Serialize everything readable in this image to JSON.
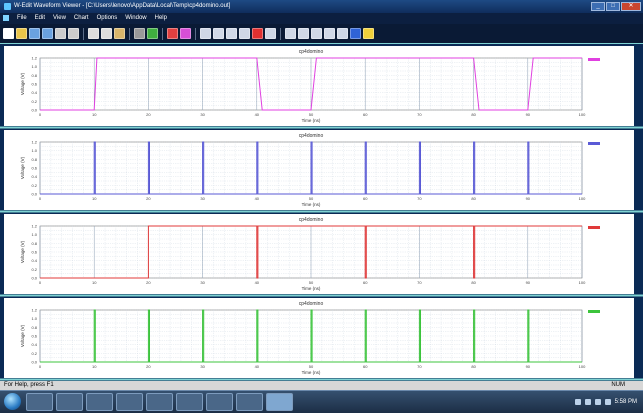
{
  "window": {
    "title": "W-Edit Waveform Viewer - [C:\\Users\\lenovo\\AppData\\Local\\Temp\\cp4domino.out]",
    "controls": [
      "_",
      "□",
      "✕"
    ]
  },
  "menu": [
    "File",
    "Edit",
    "View",
    "Chart",
    "Options",
    "Window",
    "Help"
  ],
  "toolbar_icons": [
    {
      "name": "new-icon",
      "color": "#ffffff"
    },
    {
      "name": "open-icon",
      "color": "#e8c44a"
    },
    {
      "name": "save-icon",
      "color": "#6aa2e0"
    },
    {
      "name": "save-all-icon",
      "color": "#6aa2e0"
    },
    {
      "name": "print-icon",
      "color": "#cccccc"
    },
    {
      "name": "print-preview-icon",
      "color": "#cccccc"
    },
    {
      "sep": true
    },
    {
      "name": "cut-icon",
      "color": "#dddddd"
    },
    {
      "name": "copy-icon",
      "color": "#dddddd"
    },
    {
      "name": "paste-icon",
      "color": "#d9b66b"
    },
    {
      "sep": true
    },
    {
      "name": "grid-icon",
      "color": "#9a9a9a"
    },
    {
      "name": "chart-green-icon",
      "color": "#3fae3f"
    },
    {
      "sep": true
    },
    {
      "name": "trace-red-icon",
      "color": "#e04040"
    },
    {
      "name": "trace-multi-icon",
      "color": "#d64fd6"
    },
    {
      "sep": true
    },
    {
      "name": "zoom-in-icon",
      "color": "#cfd7e6"
    },
    {
      "name": "zoom-out-icon",
      "color": "#cfd7e6"
    },
    {
      "name": "zoom-fit-icon",
      "color": "#cfd7e6"
    },
    {
      "name": "expand-icon",
      "color": "#cfd7e6"
    },
    {
      "name": "flag-red-icon",
      "color": "#e03030"
    },
    {
      "name": "cursor-icon",
      "color": "#cfd7e6"
    },
    {
      "sep": true
    },
    {
      "name": "split-icon",
      "color": "#cfd7e6"
    },
    {
      "name": "stack-icon",
      "color": "#cfd7e6"
    },
    {
      "name": "step-icon",
      "color": "#cfd7e6"
    },
    {
      "name": "pause-icon",
      "color": "#cfd7e6"
    },
    {
      "name": "play-icon",
      "color": "#cfd7e6"
    },
    {
      "name": "blue-box-icon",
      "color": "#2f63d6"
    },
    {
      "name": "bulb-icon",
      "color": "#f0d03a"
    }
  ],
  "status": {
    "left": "For Help, press F1",
    "right": "NUM"
  },
  "taskbar": {
    "time": "5:58 PM",
    "app_count": 9,
    "active_app": 8
  },
  "colors": {
    "plot_bg": "#ffffff",
    "frame_bg": "#0a2a55",
    "divider": "#7fd3d3",
    "grid": "#b9c6d6"
  },
  "chart_data": [
    {
      "type": "line",
      "title": "cp4domino",
      "xlabel": "Time (ns)",
      "ylabel": "Voltage (V)",
      "xlim": [
        0,
        100
      ],
      "ylim": [
        0,
        1.2
      ],
      "yticks": [
        "0.0",
        "0.2",
        "0.4",
        "0.6",
        "0.8",
        "1.0",
        "1.2"
      ],
      "xticks": [
        "0",
        "10",
        "20",
        "30",
        "40",
        "50",
        "60",
        "70",
        "80",
        "90",
        "100"
      ],
      "legend": "top-right",
      "series": [
        {
          "color": "#e040e0",
          "x": [
            0,
            10,
            10.5,
            40,
            41,
            50,
            51,
            80,
            81,
            90,
            91,
            100
          ],
          "y": [
            0.0,
            0.0,
            1.2,
            1.2,
            0.0,
            0.0,
            1.2,
            1.2,
            0.0,
            0.0,
            1.2,
            1.2
          ]
        }
      ]
    },
    {
      "type": "line",
      "title": "cp4domino",
      "xlabel": "Time (ns)",
      "ylabel": "Voltage (V)",
      "xlim": [
        0,
        100
      ],
      "ylim": [
        0,
        1.2
      ],
      "yticks": [
        "0.0",
        "0.2",
        "0.4",
        "0.6",
        "0.8",
        "1.0",
        "1.2"
      ],
      "xticks": [
        "0",
        "10",
        "20",
        "30",
        "40",
        "50",
        "60",
        "70",
        "80",
        "90",
        "100"
      ],
      "legend": "top-right",
      "series": [
        {
          "color": "#5a5ad6",
          "x": [
            0,
            10,
            10,
            10.2,
            10.2,
            20,
            20,
            20.2,
            20.2,
            30,
            30,
            30.2,
            30.2,
            40,
            40,
            40.2,
            40.2,
            50,
            50,
            50.2,
            50.2,
            60,
            60,
            60.2,
            60.2,
            70,
            70,
            70.2,
            70.2,
            80,
            80,
            80.2,
            80.2,
            90,
            90,
            90.2,
            90.2,
            100
          ],
          "y": [
            0,
            0,
            1.2,
            1.2,
            0,
            0,
            1.2,
            1.2,
            0,
            0,
            1.2,
            1.2,
            0,
            0,
            1.2,
            1.2,
            0,
            0,
            1.2,
            1.2,
            0,
            0,
            1.2,
            1.2,
            0,
            0,
            1.2,
            1.2,
            0,
            0,
            1.2,
            1.2,
            0,
            0,
            1.2,
            1.2,
            0,
            0
          ]
        }
      ]
    },
    {
      "type": "line",
      "title": "cp4domino",
      "xlabel": "Time (ns)",
      "ylabel": "Voltage (V)",
      "xlim": [
        0,
        100
      ],
      "ylim": [
        0,
        1.2
      ],
      "yticks": [
        "0.0",
        "0.2",
        "0.4",
        "0.6",
        "0.8",
        "1.0",
        "1.2"
      ],
      "xticks": [
        "0",
        "10",
        "20",
        "30",
        "40",
        "50",
        "60",
        "70",
        "80",
        "90",
        "100"
      ],
      "legend": "top-right",
      "series": [
        {
          "color": "#e03a3a",
          "x": [
            0,
            20,
            20,
            40,
            40,
            40.2,
            40.2,
            60,
            60,
            60.2,
            60.2,
            80,
            80,
            80.2,
            80.2,
            100
          ],
          "y": [
            0,
            0,
            1.2,
            1.2,
            0,
            0,
            1.2,
            1.2,
            0,
            0,
            1.2,
            1.2,
            0,
            0,
            1.2,
            1.2
          ]
        }
      ]
    },
    {
      "type": "line",
      "title": "cp4domino",
      "xlabel": "Time (ns)",
      "ylabel": "Voltage (V)",
      "xlim": [
        0,
        100
      ],
      "ylim": [
        0,
        1.2
      ],
      "yticks": [
        "0.0",
        "0.2",
        "0.4",
        "0.6",
        "0.8",
        "1.0",
        "1.2"
      ],
      "xticks": [
        "0",
        "10",
        "20",
        "30",
        "40",
        "50",
        "60",
        "70",
        "80",
        "90",
        "100"
      ],
      "legend": "top-right",
      "series": [
        {
          "color": "#3cc43c",
          "x": [
            0,
            10,
            10,
            10.2,
            10.2,
            20,
            20,
            20.2,
            20.2,
            30,
            30,
            30.2,
            30.2,
            40,
            40,
            40.2,
            40.2,
            50,
            50,
            50.2,
            50.2,
            60,
            60,
            60.2,
            60.2,
            70,
            70,
            70.2,
            70.2,
            80,
            80,
            80.2,
            80.2,
            90,
            90,
            90.2,
            90.2,
            100
          ],
          "y": [
            0,
            0,
            1.2,
            1.2,
            0,
            0,
            1.2,
            1.2,
            0,
            0,
            1.2,
            1.2,
            0,
            0,
            1.2,
            1.2,
            0,
            0,
            1.2,
            1.2,
            0,
            0,
            1.2,
            1.2,
            0,
            0,
            1.2,
            1.2,
            0,
            0,
            1.2,
            1.2,
            0,
            0,
            1.2,
            1.2,
            0,
            0
          ]
        }
      ]
    }
  ]
}
